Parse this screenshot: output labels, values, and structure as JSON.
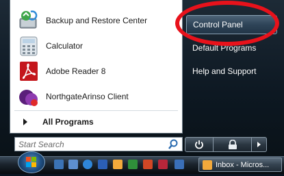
{
  "start_menu": {
    "pinned_items": [
      {
        "label": "Backup and Restore Center",
        "icon": "backup-restore-icon"
      },
      {
        "label": "Calculator",
        "icon": "calculator-icon"
      },
      {
        "label": "Adobe Reader 8",
        "icon": "adobe-reader-icon"
      },
      {
        "label": "NorthgateArinso Client",
        "icon": "northgate-client-icon"
      }
    ],
    "all_programs_label": "All Programs",
    "search": {
      "placeholder": "Start Search",
      "value": ""
    },
    "right_items": [
      {
        "label": "Control Panel",
        "highlighted": true
      },
      {
        "label": "Default Programs",
        "highlighted": false
      },
      {
        "label": "Help and Support",
        "highlighted": false
      }
    ],
    "highlight_color": "#e8121b"
  },
  "power": {
    "power_icon": "power-icon",
    "lock_icon": "lock-icon",
    "more_icon": "arrow-right-icon"
  },
  "taskbar": {
    "start_icon": "windows-orb-icon",
    "quick_launch": [
      "show-desktop-icon",
      "switch-windows-icon",
      "internet-explorer-icon",
      "word-icon",
      "outlook-icon",
      "excel-icon",
      "powerpoint-icon",
      "access-icon",
      "remote-desktop-icon"
    ],
    "task_button": {
      "label": "Inbox - Micros...",
      "icon": "outlook-icon"
    }
  }
}
